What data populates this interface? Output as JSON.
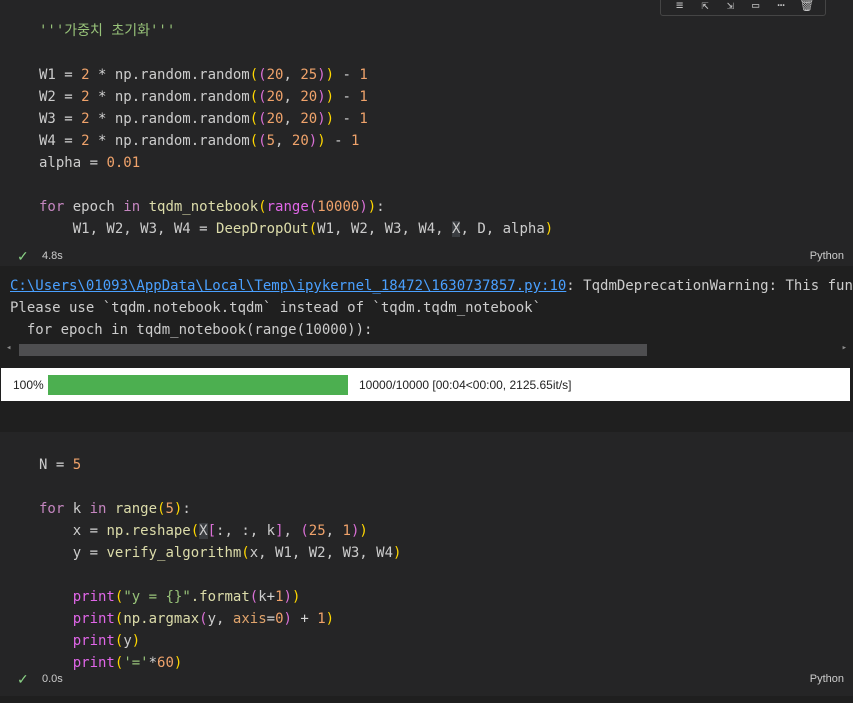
{
  "cell1": {
    "lines": [
      {
        "parts": [
          {
            "t": "'''가중치 초기화'''",
            "c": "str"
          }
        ]
      },
      {
        "parts": []
      },
      {
        "parts": [
          {
            "t": "W1 ",
            "c": "var"
          },
          {
            "t": "= ",
            "c": "op"
          },
          {
            "t": "2 ",
            "c": "num"
          },
          {
            "t": "* ",
            "c": "op"
          },
          {
            "t": "np.random.random",
            "c": "var"
          },
          {
            "t": "(",
            "c": "br1"
          },
          {
            "t": "(",
            "c": "br2"
          },
          {
            "t": "20",
            "c": "num"
          },
          {
            "t": ", ",
            "c": "var"
          },
          {
            "t": "25",
            "c": "num"
          },
          {
            "t": ")",
            "c": "br2"
          },
          {
            "t": ")",
            "c": "br1"
          },
          {
            "t": " - ",
            "c": "op"
          },
          {
            "t": "1",
            "c": "num"
          }
        ]
      },
      {
        "parts": [
          {
            "t": "W2 ",
            "c": "var"
          },
          {
            "t": "= ",
            "c": "op"
          },
          {
            "t": "2 ",
            "c": "num"
          },
          {
            "t": "* ",
            "c": "op"
          },
          {
            "t": "np.random.random",
            "c": "var"
          },
          {
            "t": "(",
            "c": "br1"
          },
          {
            "t": "(",
            "c": "br2"
          },
          {
            "t": "20",
            "c": "num"
          },
          {
            "t": ", ",
            "c": "var"
          },
          {
            "t": "20",
            "c": "num"
          },
          {
            "t": ")",
            "c": "br2"
          },
          {
            "t": ")",
            "c": "br1"
          },
          {
            "t": " - ",
            "c": "op"
          },
          {
            "t": "1",
            "c": "num"
          }
        ]
      },
      {
        "parts": [
          {
            "t": "W3 ",
            "c": "var"
          },
          {
            "t": "= ",
            "c": "op"
          },
          {
            "t": "2 ",
            "c": "num"
          },
          {
            "t": "* ",
            "c": "op"
          },
          {
            "t": "np.random.random",
            "c": "var"
          },
          {
            "t": "(",
            "c": "br1"
          },
          {
            "t": "(",
            "c": "br2"
          },
          {
            "t": "20",
            "c": "num"
          },
          {
            "t": ", ",
            "c": "var"
          },
          {
            "t": "20",
            "c": "num"
          },
          {
            "t": ")",
            "c": "br2"
          },
          {
            "t": ")",
            "c": "br1"
          },
          {
            "t": " - ",
            "c": "op"
          },
          {
            "t": "1",
            "c": "num"
          }
        ]
      },
      {
        "parts": [
          {
            "t": "W4 ",
            "c": "var"
          },
          {
            "t": "= ",
            "c": "op"
          },
          {
            "t": "2 ",
            "c": "num"
          },
          {
            "t": "* ",
            "c": "op"
          },
          {
            "t": "np.random.random",
            "c": "var"
          },
          {
            "t": "(",
            "c": "br1"
          },
          {
            "t": "(",
            "c": "br2"
          },
          {
            "t": "5",
            "c": "num"
          },
          {
            "t": ", ",
            "c": "var"
          },
          {
            "t": "20",
            "c": "num"
          },
          {
            "t": ")",
            "c": "br2"
          },
          {
            "t": ")",
            "c": "br1"
          },
          {
            "t": " - ",
            "c": "op"
          },
          {
            "t": "1",
            "c": "num"
          }
        ]
      },
      {
        "parts": [
          {
            "t": "alpha ",
            "c": "var"
          },
          {
            "t": "= ",
            "c": "op"
          },
          {
            "t": "0.01",
            "c": "num"
          }
        ]
      },
      {
        "parts": []
      },
      {
        "parts": [
          {
            "t": "for ",
            "c": "kw"
          },
          {
            "t": "epoch ",
            "c": "var"
          },
          {
            "t": "in ",
            "c": "kw"
          },
          {
            "t": "tqdm_notebook",
            "c": "fn"
          },
          {
            "t": "(",
            "c": "br1"
          },
          {
            "t": "range",
            "c": "builtin"
          },
          {
            "t": "(",
            "c": "br2"
          },
          {
            "t": "10000",
            "c": "num"
          },
          {
            "t": ")",
            "c": "br2"
          },
          {
            "t": ")",
            "c": "br1"
          },
          {
            "t": ":",
            "c": "var"
          }
        ]
      },
      {
        "parts": [
          {
            "t": "    W1, W2, W3, W4 ",
            "c": "var"
          },
          {
            "t": "= ",
            "c": "op"
          },
          {
            "t": "DeepDropOut",
            "c": "fn"
          },
          {
            "t": "(",
            "c": "br1"
          },
          {
            "t": "W1, W2, W3, W4, ",
            "c": "var"
          },
          {
            "t": "X",
            "c": "hl"
          },
          {
            "t": ", D, alpha",
            "c": "var"
          },
          {
            "t": ")",
            "c": "br1"
          }
        ]
      }
    ],
    "time": "4.8s",
    "lang": "Python"
  },
  "output": {
    "link": "C:\\Users\\01093\\AppData\\Local\\Temp\\ipykernel_18472\\1630737857.py:10",
    "warning_rest": ": TqdmDeprecationWarning: This function",
    "line2": "Please use `tqdm.notebook.tqdm` instead of `tqdm.tqdm_notebook`",
    "line3": "  for epoch in tqdm_notebook(range(10000)):",
    "progress_pct": "100%",
    "progress_fraction": 1.0,
    "progress_text": "10000/10000  [00:04<00:00,  2125.65it/s]",
    "progress_color": "#4caf50"
  },
  "cell2": {
    "lines": [
      {
        "parts": [
          {
            "t": "N ",
            "c": "var"
          },
          {
            "t": "= ",
            "c": "op"
          },
          {
            "t": "5",
            "c": "num"
          }
        ]
      },
      {
        "parts": []
      },
      {
        "parts": [
          {
            "t": "for ",
            "c": "kw"
          },
          {
            "t": "k ",
            "c": "var"
          },
          {
            "t": "in ",
            "c": "kw"
          },
          {
            "t": "range",
            "c": "fn"
          },
          {
            "t": "(",
            "c": "br1"
          },
          {
            "t": "5",
            "c": "num"
          },
          {
            "t": ")",
            "c": "br1"
          },
          {
            "t": ":",
            "c": "var"
          }
        ]
      },
      {
        "parts": [
          {
            "t": "    x ",
            "c": "var"
          },
          {
            "t": "= ",
            "c": "op"
          },
          {
            "t": "np.reshape",
            "c": "fn"
          },
          {
            "t": "(",
            "c": "br1"
          },
          {
            "t": "X",
            "c": "hl"
          },
          {
            "t": "[",
            "c": "br2"
          },
          {
            "t": ":, :, k",
            "c": "var"
          },
          {
            "t": "]",
            "c": "br2"
          },
          {
            "t": ", ",
            "c": "var"
          },
          {
            "t": "(",
            "c": "br2"
          },
          {
            "t": "25",
            "c": "num"
          },
          {
            "t": ", ",
            "c": "var"
          },
          {
            "t": "1",
            "c": "num"
          },
          {
            "t": ")",
            "c": "br2"
          },
          {
            "t": ")",
            "c": "br1"
          }
        ]
      },
      {
        "parts": [
          {
            "t": "    y ",
            "c": "var"
          },
          {
            "t": "= ",
            "c": "op"
          },
          {
            "t": "verify_algorithm",
            "c": "fn"
          },
          {
            "t": "(",
            "c": "br1"
          },
          {
            "t": "x, W1, W2, W3, W4",
            "c": "var"
          },
          {
            "t": ")",
            "c": "br1"
          }
        ]
      },
      {
        "parts": []
      },
      {
        "parts": [
          {
            "t": "    ",
            "c": "var"
          },
          {
            "t": "print",
            "c": "builtin"
          },
          {
            "t": "(",
            "c": "br1"
          },
          {
            "t": "\"y = {}\"",
            "c": "str"
          },
          {
            "t": ".format",
            "c": "fn"
          },
          {
            "t": "(",
            "c": "br2"
          },
          {
            "t": "k",
            "c": "var"
          },
          {
            "t": "+",
            "c": "op"
          },
          {
            "t": "1",
            "c": "num"
          },
          {
            "t": ")",
            "c": "br2"
          },
          {
            "t": ")",
            "c": "br1"
          }
        ]
      },
      {
        "parts": [
          {
            "t": "    ",
            "c": "var"
          },
          {
            "t": "print",
            "c": "builtin"
          },
          {
            "t": "(",
            "c": "br1"
          },
          {
            "t": "np.argmax",
            "c": "fn"
          },
          {
            "t": "(",
            "c": "br2"
          },
          {
            "t": "y, ",
            "c": "var"
          },
          {
            "t": "axis",
            "c": "param"
          },
          {
            "t": "=",
            "c": "op"
          },
          {
            "t": "0",
            "c": "num"
          },
          {
            "t": ")",
            "c": "br2"
          },
          {
            "t": " + ",
            "c": "op"
          },
          {
            "t": "1",
            "c": "num"
          },
          {
            "t": ")",
            "c": "br1"
          }
        ]
      },
      {
        "parts": [
          {
            "t": "    ",
            "c": "var"
          },
          {
            "t": "print",
            "c": "builtin"
          },
          {
            "t": "(",
            "c": "br1"
          },
          {
            "t": "y",
            "c": "var"
          },
          {
            "t": ")",
            "c": "br1"
          }
        ]
      },
      {
        "parts": [
          {
            "t": "    ",
            "c": "var"
          },
          {
            "t": "print",
            "c": "builtin"
          },
          {
            "t": "(",
            "c": "br1"
          },
          {
            "t": "'='",
            "c": "str"
          },
          {
            "t": "*",
            "c": "op"
          },
          {
            "t": "60",
            "c": "num"
          },
          {
            "t": ")",
            "c": "br1"
          }
        ]
      }
    ],
    "time": "0.0s",
    "lang": "Python"
  },
  "toolbar_icons": [
    "run-by-line-icon",
    "execute-above-icon",
    "execute-below-icon",
    "split-cell-icon",
    "more-icon",
    "delete-icon"
  ]
}
